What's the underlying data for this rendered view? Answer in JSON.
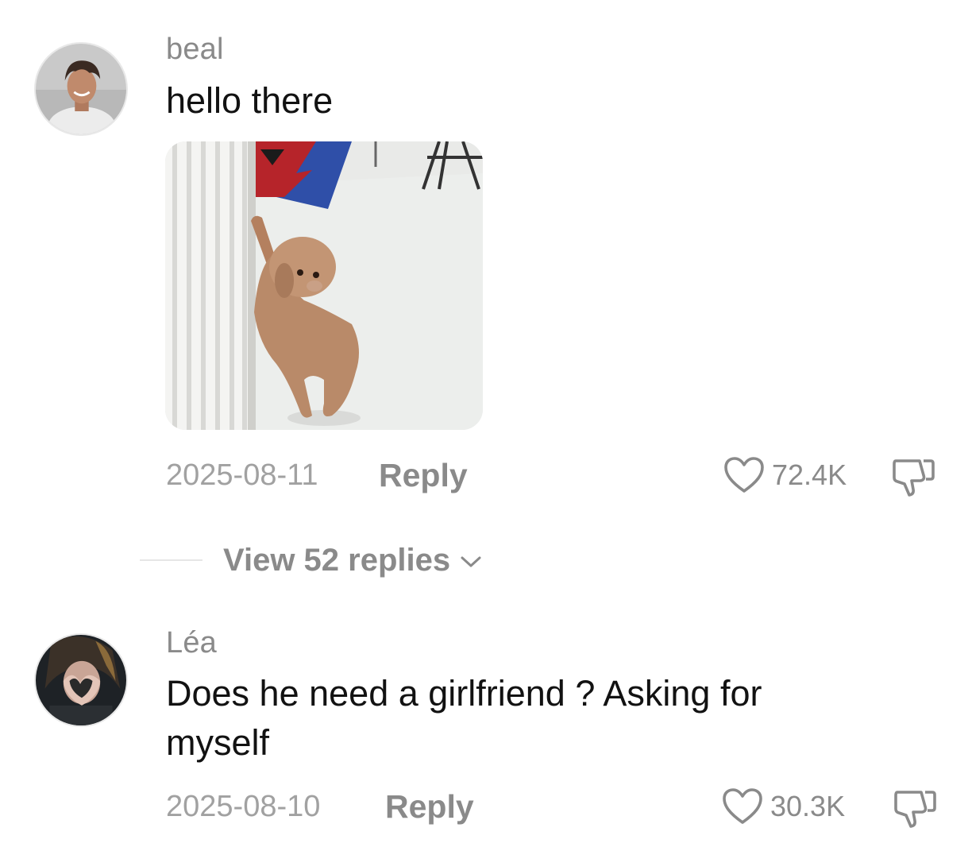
{
  "comments": [
    {
      "username": "beal",
      "text": "hello there",
      "has_image": true,
      "image_alt": "dog-image",
      "date": "2025-08-11",
      "reply_label": "Reply",
      "likes": "72.4K",
      "replies_label": "View 52 replies"
    },
    {
      "username": "Léa",
      "text": "Does he need a girlfriend ? Asking for myself",
      "has_image": false,
      "date": "2025-08-10",
      "reply_label": "Reply",
      "likes": "30.3K"
    }
  ],
  "icons": {
    "like": "heart-outline-icon",
    "dislike": "thumbs-down-outline-icon",
    "expand": "chevron-down-icon"
  },
  "colors": {
    "text_primary": "#121212",
    "text_secondary": "#8a8a8a",
    "text_tertiary": "#a1a1a1",
    "background": "#ffffff"
  }
}
